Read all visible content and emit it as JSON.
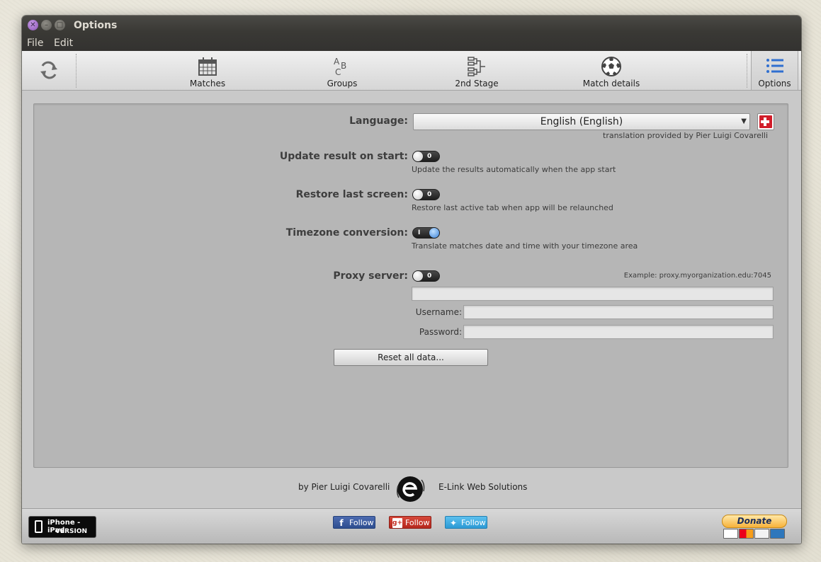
{
  "window": {
    "title": "Options"
  },
  "menu": {
    "file": "File",
    "edit": "Edit"
  },
  "toolbar": {
    "matches": "Matches",
    "groups": "Groups",
    "second_stage": "2nd Stage",
    "match_details": "Match details",
    "options": "Options",
    "active_tab": "Options"
  },
  "form": {
    "language_label": "Language:",
    "language_value": "English (English)",
    "translation_credit": "translation provided by Pier Luigi Covarelli",
    "update_label": "Update result on start:",
    "update_state": "0",
    "update_hint": "Update the results automatically when the app start",
    "restore_label": "Restore last screen:",
    "restore_state": "0",
    "restore_hint": "Restore last active tab when app will be relaunched",
    "timezone_label": "Timezone conversion:",
    "timezone_state": "I",
    "timezone_hint": "Translate matches date and time with your timezone area",
    "proxy_label": "Proxy server:",
    "proxy_state": "0",
    "proxy_example": "Example: proxy.myorganization.edu:7045",
    "proxy_value": "",
    "username_label": "Username:",
    "username_value": "",
    "password_label": "Password:",
    "password_value": "",
    "reset_button": "Reset all data..."
  },
  "credits": {
    "author": "by Pier Luigi Covarelli",
    "company": "E-Link Web Solutions"
  },
  "footer": {
    "badge_line1": "iPhone - iPad",
    "badge_line2": "VERSION",
    "facebook_follow": "Follow",
    "googleplus_follow": "Follow",
    "twitter_follow": "Follow",
    "donate": "Donate"
  },
  "colors": {
    "titlebar": "#3a3935",
    "panel": "#b6b6b6",
    "active_tab_icon": "#2f6fd0",
    "toggle_on": "#3b82d8",
    "facebook": "#3b5998",
    "googleplus": "#c4302b",
    "twitter": "#33aadd"
  },
  "icons": [
    "refresh-icon",
    "calendar-icon",
    "abc-icon",
    "bracket-icon",
    "soccer-ball-icon",
    "list-icon",
    "swiss-flag-icon"
  ]
}
